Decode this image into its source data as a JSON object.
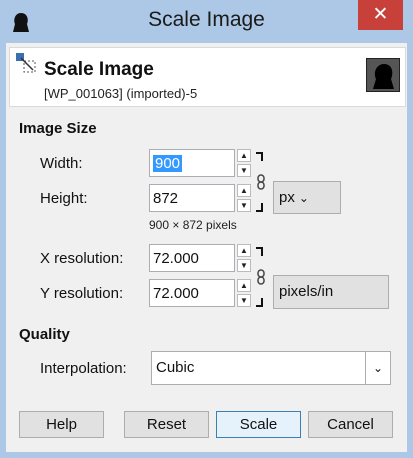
{
  "window": {
    "title": "Scale Image",
    "close_symbol": "✕"
  },
  "header": {
    "title": "Scale Image",
    "subtitle": "[WP_001063] (imported)-5"
  },
  "image_size": {
    "section_label": "Image Size",
    "width": {
      "label": "Width:",
      "value": "900"
    },
    "height": {
      "label": "Height:",
      "value": "872"
    },
    "unit": "px",
    "dimensions_hint": "900 × 872 pixels",
    "x_resolution": {
      "label": "X resolution:",
      "value": "72.000"
    },
    "y_resolution": {
      "label": "Y resolution:",
      "value": "72.000"
    },
    "resolution_unit": "pixels/in"
  },
  "quality": {
    "section_label": "Quality",
    "interpolation": {
      "label": "Interpolation:",
      "value": "Cubic"
    }
  },
  "buttons": {
    "help": "Help",
    "reset": "Reset",
    "scale": "Scale",
    "cancel": "Cancel"
  }
}
